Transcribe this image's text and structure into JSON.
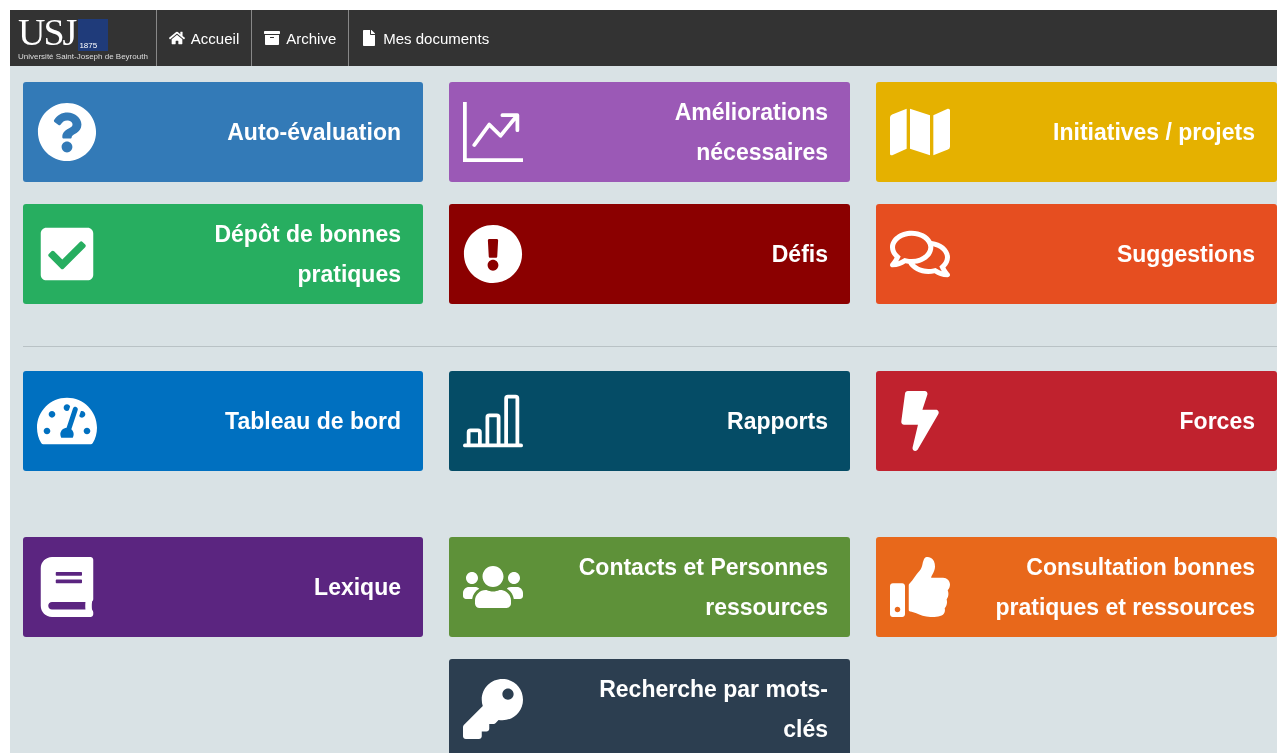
{
  "navbar": {
    "logo": {
      "letters": "USJ",
      "year": "1875",
      "subtitle": "Université Saint-Joseph de Beyrouth"
    },
    "links": [
      {
        "label": "Accueil"
      },
      {
        "label": "Archive"
      },
      {
        "label": "Mes documents"
      }
    ]
  },
  "sections": [
    {
      "rows": [
        [
          {
            "label": "Auto-évaluation",
            "color": "#337ab7"
          },
          {
            "label": "Améliorations nécessaires",
            "color": "#9b59b6"
          },
          {
            "label": "Initiatives / projets",
            "color": "#e5b100"
          }
        ],
        [
          {
            "label": "Dépôt de bonnes pratiques",
            "color": "#27ae60"
          },
          {
            "label": "Défis",
            "color": "#8b0000"
          },
          {
            "label": "Suggestions",
            "color": "#e64e20"
          }
        ]
      ]
    },
    {
      "rows": [
        [
          {
            "label": "Tableau de bord",
            "color": "#0070c0"
          },
          {
            "label": "Rapports",
            "color": "#054c66"
          },
          {
            "label": "Forces",
            "color": "#c0222e"
          }
        ]
      ]
    },
    {
      "rows": [
        [
          {
            "label": "Lexique",
            "color": "#5b2580"
          },
          {
            "label": "Contacts et Personnes ressources",
            "color": "#5e9139"
          },
          {
            "label": "Consultation bonnes pratiques et ressources",
            "color": "#e8681b"
          }
        ],
        [
          null,
          {
            "label": "Recherche par mots-clés",
            "color": "#2c3e50"
          },
          null
        ]
      ]
    }
  ]
}
